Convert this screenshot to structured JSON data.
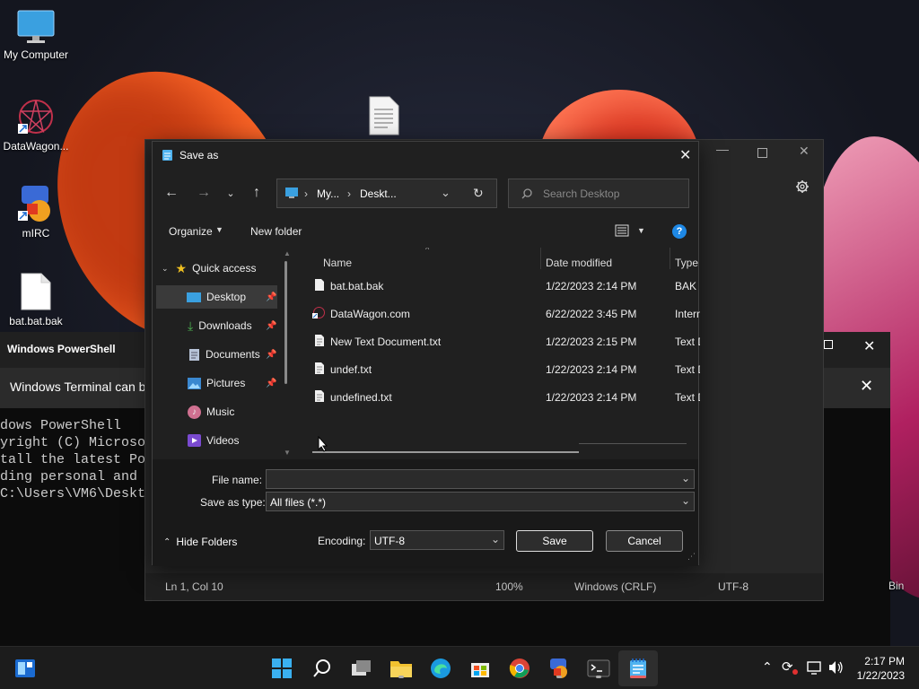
{
  "desktop": {
    "icons": [
      {
        "label": "My Computer",
        "icon": "monitor-icon"
      },
      {
        "label": "DataWagon...",
        "icon": "datawagon-icon"
      },
      {
        "label": "mIRC",
        "icon": "mirc-icon"
      },
      {
        "label": "bat.bat.bak",
        "icon": "file-icon"
      }
    ],
    "recycle_bin_partial": "Bin"
  },
  "terminal": {
    "title": "Windows PowerShell",
    "banner": "Windows Terminal can b",
    "lines": [
      "dows PowerShell",
      "yright (C) Microso",
      "",
      "tall the latest Po",
      "",
      "ding personal and",
      "C:\\Users\\VM6\\Deskt"
    ]
  },
  "notepad": {
    "status": {
      "position": "Ln 1, Col 10",
      "zoom": "100%",
      "line_ending": "Windows (CRLF)",
      "encoding": "UTF-8"
    }
  },
  "dialog": {
    "title": "Save as",
    "address": {
      "seg1": "My...",
      "seg2": "Deskt..."
    },
    "search_placeholder": "Search Desktop",
    "organize_label": "Organize",
    "new_folder_label": "New folder",
    "nav_items": [
      {
        "label": "Quick access",
        "icon": "star-icon"
      },
      {
        "label": "Desktop",
        "icon": "desktop-folder-icon",
        "selected": true,
        "pinned": true
      },
      {
        "label": "Downloads",
        "icon": "download-icon",
        "pinned": true
      },
      {
        "label": "Documents",
        "icon": "documents-icon",
        "pinned": true
      },
      {
        "label": "Pictures",
        "icon": "pictures-icon",
        "pinned": true
      },
      {
        "label": "Music",
        "icon": "music-icon"
      },
      {
        "label": "Videos",
        "icon": "videos-icon"
      }
    ],
    "columns": {
      "name": "Name",
      "date": "Date modified",
      "type": "Type"
    },
    "files": [
      {
        "name": "bat.bat.bak",
        "date": "1/22/2023 2:14 PM",
        "type": "BAK File"
      },
      {
        "name": "DataWagon.com",
        "date": "6/22/2022 3:45 PM",
        "type": "Internet"
      },
      {
        "name": "New Text Document.txt",
        "date": "1/22/2023 2:15 PM",
        "type": "Text Doc"
      },
      {
        "name": "undef.txt",
        "date": "1/22/2023 2:14 PM",
        "type": "Text Doc"
      },
      {
        "name": "undefined.txt",
        "date": "1/22/2023 2:14 PM",
        "type": "Text Doc"
      }
    ],
    "file_name_label": "File name:",
    "file_name_value": "",
    "save_type_label": "Save as type:",
    "save_type_value": "All files  (*.*)",
    "hide_folders_label": "Hide Folders",
    "encoding_label": "Encoding:",
    "encoding_value": "UTF-8",
    "save_label": "Save",
    "cancel_label": "Cancel"
  },
  "taskbar": {
    "time": "2:17 PM",
    "date": "1/22/2023",
    "apps": [
      "start-icon",
      "search-icon",
      "task-view-icon",
      "file-explorer-icon",
      "edge-icon",
      "store-icon",
      "chrome-icon",
      "mirc-icon",
      "terminal-icon",
      "notepad-icon"
    ]
  },
  "colors": {
    "accent": "#0078d4",
    "dialog_bg": "#202020",
    "selected": "#3a3a3a"
  }
}
